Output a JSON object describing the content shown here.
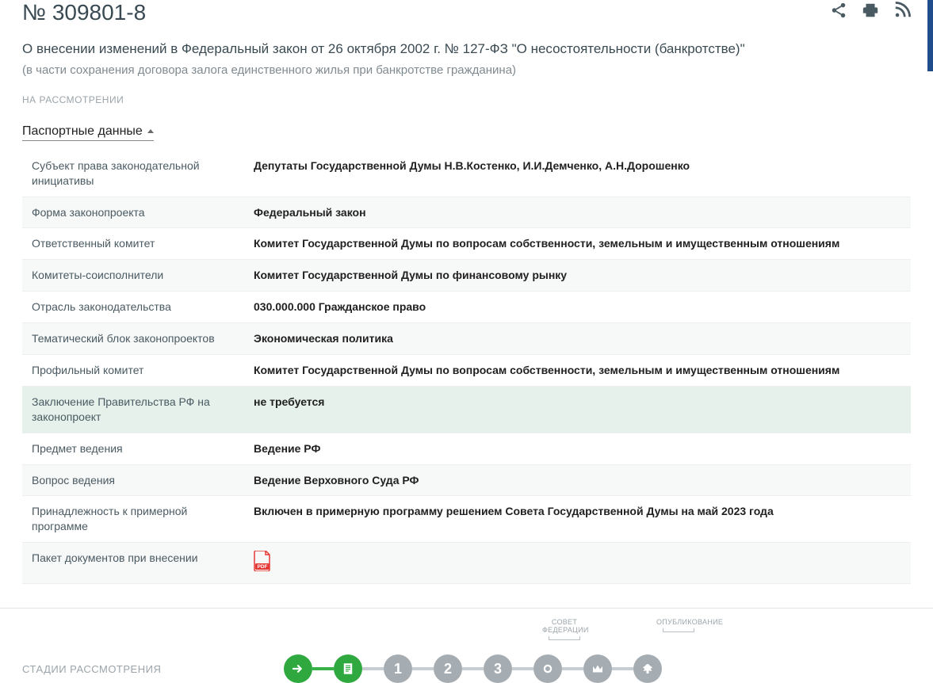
{
  "header": {
    "bill_number": "№ 309801-8",
    "title": "О внесении изменений в Федеральный закон от 26 октября 2002 г. № 127-ФЗ \"О несостоятельности (банкротстве)\"",
    "subtitle": "(в части сохранения договора залога единственного жилья при банкротстве гражданина)",
    "status": "НА РАССМОТРЕНИИ"
  },
  "section": {
    "title": "Паспортные данные"
  },
  "table": {
    "rows": [
      {
        "label": "Субъект права законодательной инициативы",
        "value": "Депутаты Государственной Думы Н.В.Костенко, И.И.Демченко, А.Н.Дорошенко",
        "highlight": false
      },
      {
        "label": "Форма законопроекта",
        "value": "Федеральный закон",
        "highlight": false
      },
      {
        "label": "Ответственный комитет",
        "value": "Комитет Государственной Думы по вопросам собственности, земельным и имущественным отношениям",
        "highlight": false
      },
      {
        "label": "Комитеты-соисполнители",
        "value": "Комитет Государственной Думы по финансовому рынку",
        "highlight": false
      },
      {
        "label": "Отрасль законодательства",
        "value": "030.000.000 Гражданское право",
        "highlight": false
      },
      {
        "label": "Тематический блок законопроектов",
        "value": "Экономическая политика",
        "highlight": false
      },
      {
        "label": "Профильный комитет",
        "value": "Комитет Государственной Думы по вопросам собственности, земельным и имущественным отношениям",
        "highlight": false
      },
      {
        "label": "Заключение Правительства РФ на законопроект",
        "value": "не требуется",
        "highlight": true
      },
      {
        "label": "Предмет ведения",
        "value": "Ведение РФ",
        "highlight": false
      },
      {
        "label": "Вопрос ведения",
        "value": "Ведение Верховного Суда РФ",
        "highlight": false
      },
      {
        "label": "Принадлежность к примерной программе",
        "value": "Включен в примерную программу решением Совета Государственной Думы на май 2023 года",
        "highlight": false
      },
      {
        "label": "Пакет документов при внесении",
        "value": "",
        "highlight": false,
        "pdf": true
      }
    ]
  },
  "stages": {
    "title": "СТАДИИ РАССМОТРЕНИЯ",
    "top_labels": [
      "СОВЕТ ФЕДЕРАЦИИ",
      "ОПУБЛИКОВАНИЕ"
    ],
    "items": [
      {
        "kind": "icon-arrow",
        "color": "green"
      },
      {
        "kind": "icon-doc",
        "color": "green"
      },
      {
        "kind": "num",
        "text": "1",
        "color": "grey"
      },
      {
        "kind": "num",
        "text": "2",
        "color": "grey"
      },
      {
        "kind": "num",
        "text": "3",
        "color": "grey"
      },
      {
        "kind": "icon-seal",
        "color": "grey"
      },
      {
        "kind": "icon-crown",
        "color": "grey"
      },
      {
        "kind": "icon-eagle",
        "color": "grey"
      }
    ]
  }
}
